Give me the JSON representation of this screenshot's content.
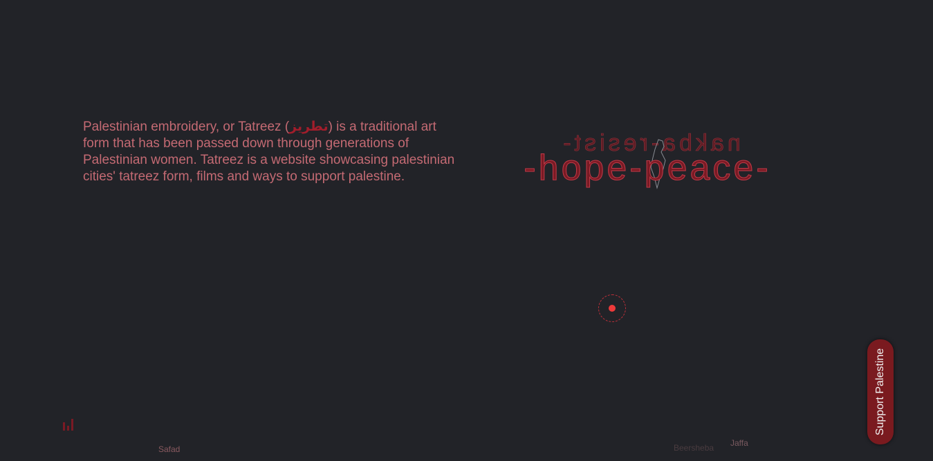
{
  "intro": {
    "before": "Palestinian embroidery, or Tatreez (",
    "arabic": "تطريز",
    "after": ") is a traditional art form that has been passed down through generations of Palestinian women. Tatreez is a website showcasing palestinian cities' tatreez form, films and ways to support palestine."
  },
  "ring_text": {
    "back": "nakba-resist-",
    "front": "-hope-peace-"
  },
  "support_button": {
    "label": "Support Palestine"
  },
  "cities": {
    "safad": "Safad",
    "beersheba": "Beersheba",
    "jaffa": "Jaffa"
  },
  "colors": {
    "background": "#222328",
    "text": "#c46a73",
    "accent": "#7a1a1f",
    "cursor": "#ee3a3a"
  },
  "icons": {
    "sound": "sound-bars-icon",
    "map": "palestine-map-icon"
  }
}
